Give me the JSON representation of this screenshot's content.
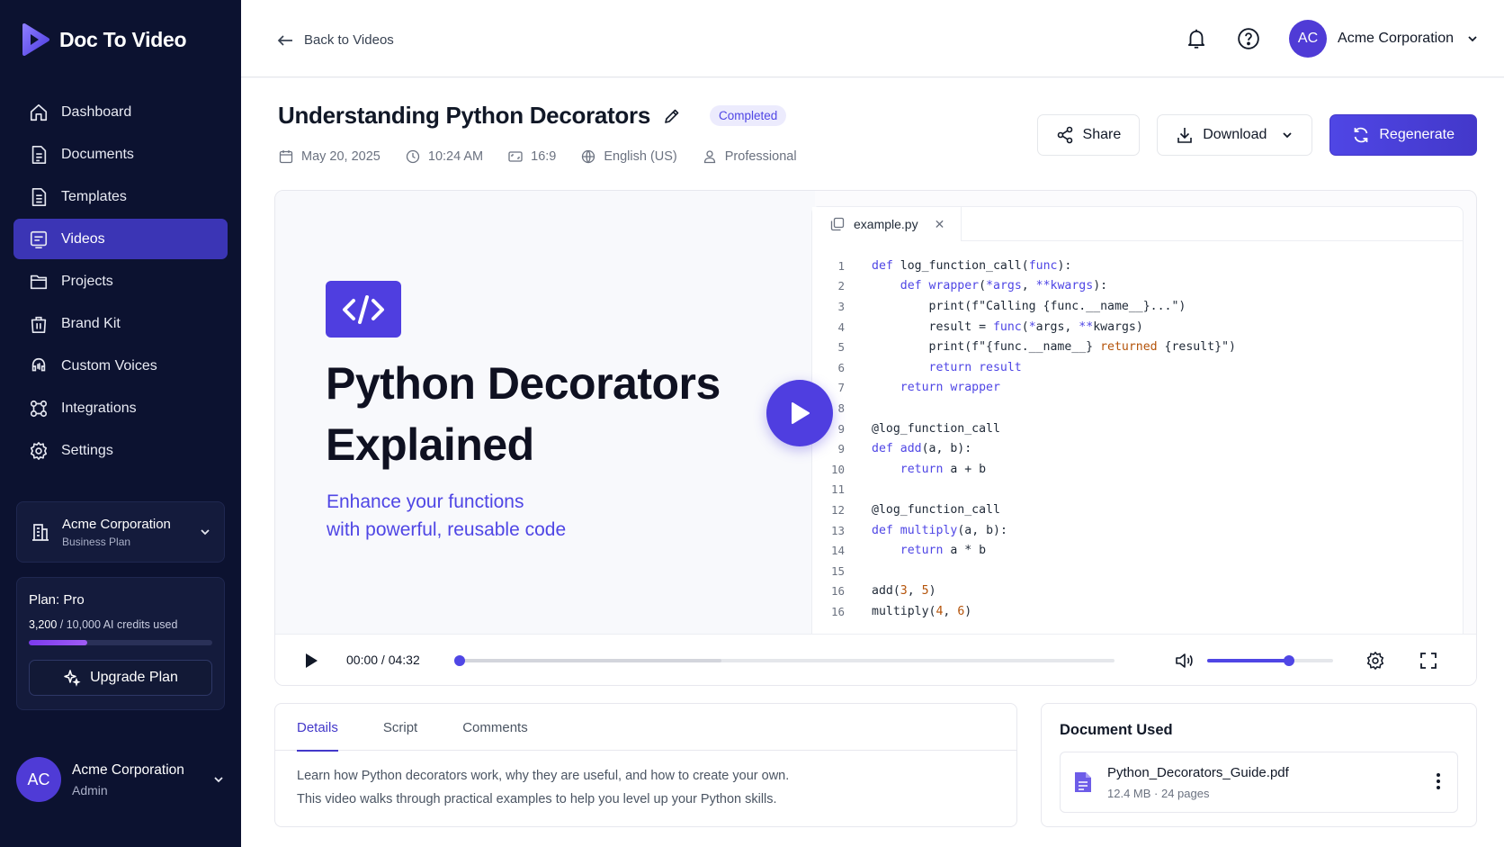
{
  "app": {
    "name": "Doc To Video"
  },
  "sidebar": {
    "items": [
      {
        "label": "Dashboard",
        "icon": "home-icon"
      },
      {
        "label": "Documents",
        "icon": "document-icon"
      },
      {
        "label": "Templates",
        "icon": "template-icon"
      },
      {
        "label": "Videos",
        "icon": "video-icon",
        "active": true
      },
      {
        "label": "Projects",
        "icon": "folder-icon"
      },
      {
        "label": "Brand Kit",
        "icon": "bag-icon"
      },
      {
        "label": "Custom Voices",
        "icon": "voice-icon"
      },
      {
        "label": "Integrations",
        "icon": "integrations-icon"
      },
      {
        "label": "Settings",
        "icon": "gear-icon"
      }
    ],
    "org": {
      "name": "Acme Corporation",
      "plan": "Business Plan"
    },
    "plan_card": {
      "title": "Plan: Pro",
      "used": "3,200",
      "total": " / 10,000 AI credits used",
      "usage_fraction": 0.32,
      "upgrade_label": "Upgrade Plan"
    },
    "user": {
      "initials": "AC",
      "name": "Acme Corporation",
      "role": "Admin"
    }
  },
  "header": {
    "back_label": "Back to Videos",
    "account_initials": "AC",
    "account_name": "Acme Corporation"
  },
  "video": {
    "title": "Understanding Python Decorators",
    "status": "Completed",
    "meta": {
      "date": "May 20, 2025",
      "time": "10:24 AM",
      "aspect": "16:9",
      "language": "English (US)",
      "style": "Professional"
    },
    "actions": {
      "share": "Share",
      "download": "Download",
      "regenerate": "Regenerate"
    }
  },
  "slide": {
    "title_line1": "Python Decorators",
    "title_line2": "Explained",
    "subtitle_line1": "Enhance your functions",
    "subtitle_line2": "with powerful, reusable code",
    "file_tab": "example.py",
    "code_lines": [
      {
        "n": "1",
        "html": "<span class='kw'>def</span> log_function_call(<span class='kw'>func</span>):"
      },
      {
        "n": "2",
        "html": "    <span class='kw'>def</span> <span class='kw'>wrapper</span>(<span class='kw'>*args</span>, <span class='kw'>**kwargs</span>):"
      },
      {
        "n": "3",
        "html": "        print(f\"Calling {func.__name__}...\")"
      },
      {
        "n": "4",
        "html": "        result = <span class='kw'>func</span>(<span class='kw'>*</span>args, <span class='kw'>**</span>kwargs)"
      },
      {
        "n": "5",
        "html": "        print(f\"{func.__name__} <span class='str'>returned</span> {result}\")"
      },
      {
        "n": "6",
        "html": "        <span class='kw'>return result</span>"
      },
      {
        "n": "7",
        "html": "    <span class='kw'>return wrapper</span>"
      },
      {
        "n": "8",
        "html": ""
      },
      {
        "n": "9",
        "html": "@log_function_call"
      },
      {
        "n": "9",
        "html": "<span class='kw'>def</span> <span class='kw'>add</span>(a, b):"
      },
      {
        "n": "10",
        "html": "    <span class='kw'>return</span> a + b"
      },
      {
        "n": "11",
        "html": ""
      },
      {
        "n": "12",
        "html": "@log_function_call"
      },
      {
        "n": "13",
        "html": "<span class='kw'>def</span> <span class='kw'>multiply</span>(a, b):"
      },
      {
        "n": "14",
        "html": "    <span class='kw'>return</span> a * b"
      },
      {
        "n": "15",
        "html": ""
      },
      {
        "n": "16",
        "html": "add(<span class='num'>3</span>, <span class='num'>5</span>)"
      },
      {
        "n": "16",
        "html": "multiply(<span class='num'>4</span>, <span class='num'>6</span>)"
      }
    ]
  },
  "player": {
    "time": "00:00 / 04:32",
    "progress_fraction": 0.0,
    "buffered_fraction": 0.4,
    "volume_fraction": 0.65
  },
  "details": {
    "tabs": [
      "Details",
      "Script",
      "Comments"
    ],
    "active_tab": "Details",
    "description_line1": "Learn how Python decorators work, why they are useful, and how to create your own.",
    "description_line2": "This video walks through practical examples to help you level up your Python skills."
  },
  "document": {
    "heading": "Document Used",
    "file_name": "Python_Decorators_Guide.pdf",
    "size": "12.4 MB",
    "pages": "24 pages"
  },
  "colors": {
    "accent": "#4f46e5",
    "sidebar_bg": "#0c1230",
    "active_nav": "#3b35b5"
  }
}
